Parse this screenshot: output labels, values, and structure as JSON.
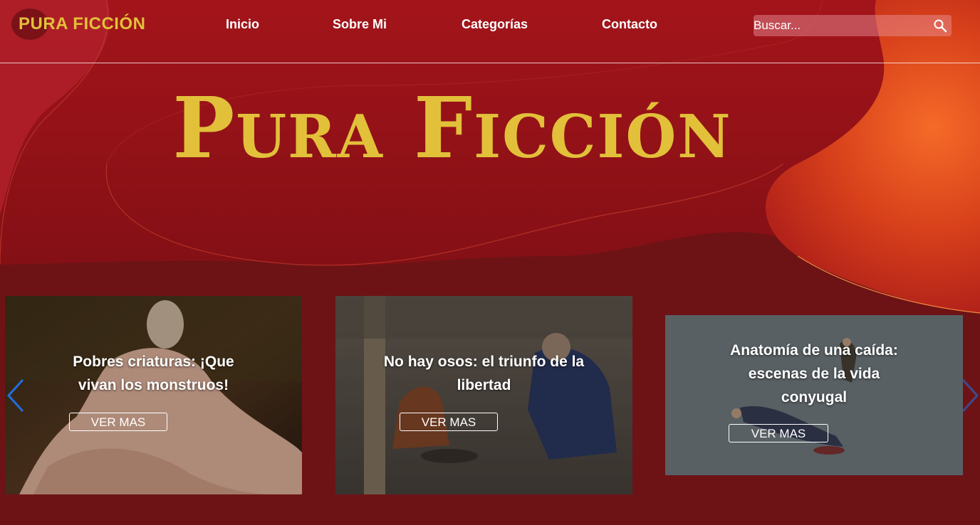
{
  "brand": {
    "logo_text": "PURA FICCIÓN",
    "hero_title": "Pura Ficción",
    "accent": "#e2c03a"
  },
  "nav": [
    {
      "label": "Inicio"
    },
    {
      "label": "Sobre Mi"
    },
    {
      "label": "Categorías"
    },
    {
      "label": "Contacto"
    }
  ],
  "search": {
    "placeholder": "Buscar...",
    "icon": "search-icon"
  },
  "carousel": {
    "prev_icon": "chevron-left-icon",
    "next_icon": "chevron-right-icon",
    "cards": [
      {
        "title": "Pobres criaturas: ¡Que vivan los monstruos!",
        "button": "VER MAS"
      },
      {
        "title": "No hay osos: el triunfo de la libertad",
        "button": "VER MAS"
      },
      {
        "title": "Anatomía de una caída: escenas de la vida conyugal",
        "button": "VER MAS"
      }
    ]
  },
  "colors": {
    "background": "#6d1316",
    "hero_red": "#9c1113",
    "orange": "#f06b2a",
    "arrow_blue": "#1f6fe0"
  }
}
